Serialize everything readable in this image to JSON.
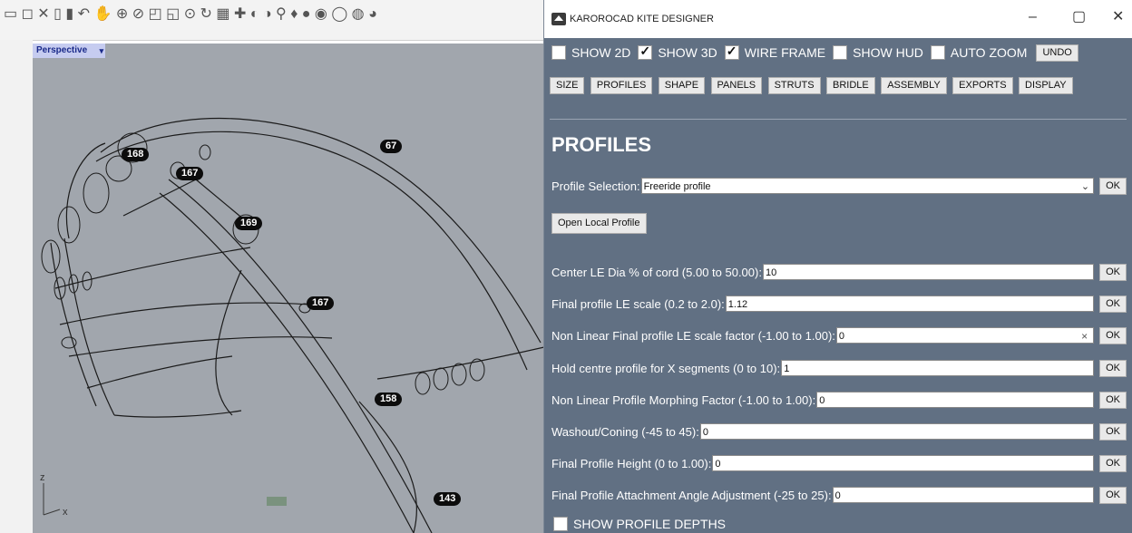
{
  "rhino": {
    "viewport_title": "Perspective",
    "axis_z": "z",
    "axis_x": "x",
    "labels": [
      "168",
      "167",
      "67",
      "169",
      "167",
      "158",
      "143"
    ]
  },
  "designer": {
    "window_title": "KAROROCAD KITE DESIGNER",
    "toggles": [
      {
        "label": "SHOW 2D",
        "checked": false
      },
      {
        "label": "SHOW 3D",
        "checked": true
      },
      {
        "label": "WIRE FRAME",
        "checked": true
      },
      {
        "label": "SHOW HUD",
        "checked": false
      },
      {
        "label": "AUTO ZOOM",
        "checked": false
      }
    ],
    "undo_label": "UNDO",
    "nav": [
      "SIZE",
      "PROFILES",
      "SHAPE",
      "PANELS",
      "STRUTS",
      "BRIDLE",
      "ASSEMBLY",
      "EXPORTS",
      "DISPLAY"
    ],
    "section_title": "PROFILES",
    "profile_selection_label": "Profile Selection:",
    "profile_selection_value": "Freeride profile",
    "open_local_profile": "Open Local Profile",
    "ok_label": "OK",
    "fields": [
      {
        "label": "Center LE Dia % of cord (5.00 to 50.00):",
        "value": "10"
      },
      {
        "label": "Final profile LE scale (0.2 to 2.0):",
        "value": "1.12"
      },
      {
        "label": "Non Linear Final profile LE scale factor (-1.00 to 1.00):",
        "value": "0"
      },
      {
        "label": "Hold centre profile for X segments (0 to 10):",
        "value": "1"
      },
      {
        "label": "Non Linear Profile Morphing Factor (-1.00 to 1.00):",
        "value": "0"
      },
      {
        "label": "Washout/Coning (-45 to 45):",
        "value": "0"
      },
      {
        "label": "Final Profile Height (0 to 1.00):",
        "value": "0"
      },
      {
        "label": "Final Profile Attachment Angle Adjustment (-25 to 25):",
        "value": "0"
      }
    ],
    "show_profile_depths": "SHOW PROFILE DEPTHS"
  }
}
